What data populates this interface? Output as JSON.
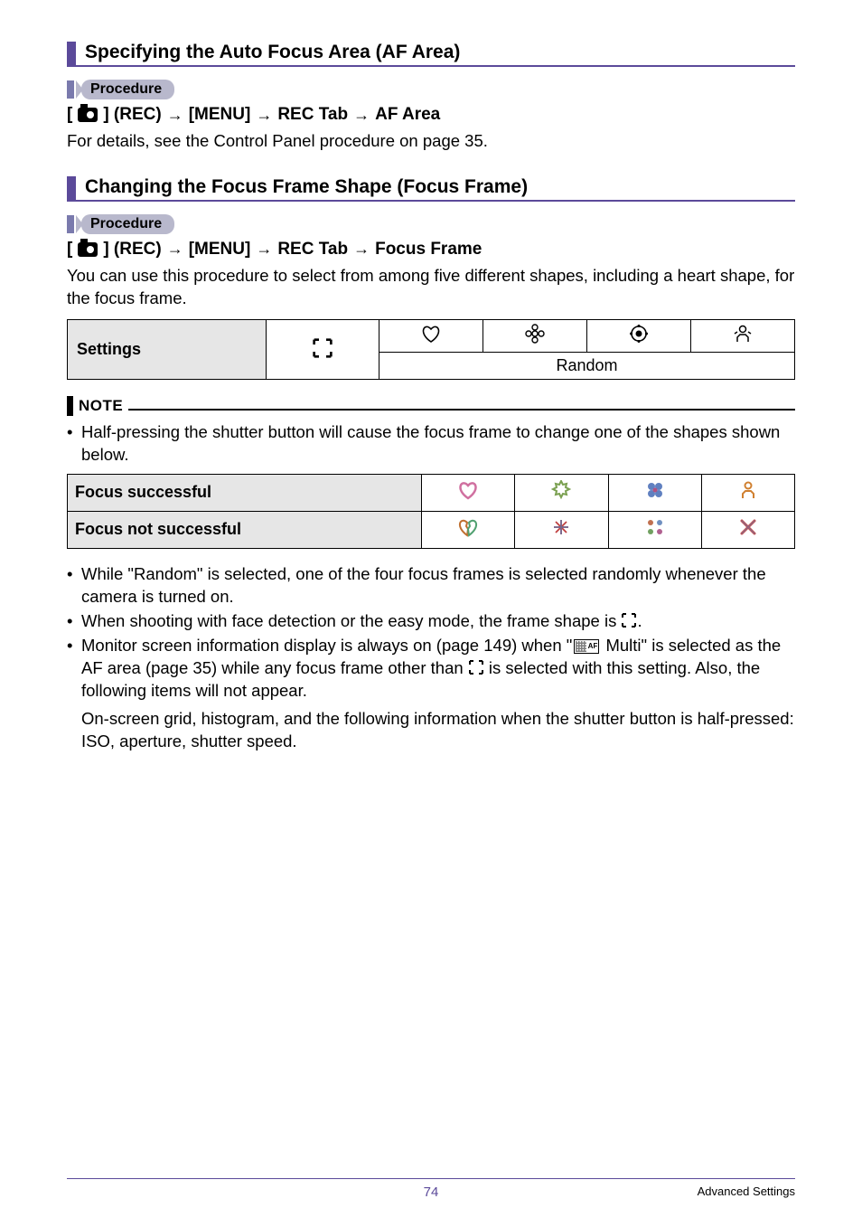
{
  "sections": {
    "af_area": {
      "title": "Specifying the Auto Focus Area (AF Area)",
      "procedure_label": "Procedure",
      "path": [
        "[",
        "] (REC)",
        "[MENU]",
        "REC Tab",
        "AF Area"
      ],
      "body": "For details, see the Control Panel procedure on page 35."
    },
    "focus_frame": {
      "title": "Changing the Focus Frame Shape (Focus Frame)",
      "procedure_label": "Procedure",
      "path": [
        "[",
        "] (REC)",
        "[MENU]",
        "REC Tab",
        "Focus Frame"
      ],
      "intro": "You can use this procedure to select from among five different shapes, including a heart shape, for the focus frame."
    }
  },
  "settings_table": {
    "label": "Settings",
    "shapes": [
      "heart",
      "flower",
      "clover-ring",
      "person"
    ],
    "random_label": "Random"
  },
  "note": {
    "label": "NOTE",
    "bullet1": "Half-pressing the shutter button will cause the focus frame to change one of the shapes shown below."
  },
  "focus_table": {
    "row1": "Focus successful",
    "row2": "Focus not successful"
  },
  "bullets_after": {
    "b1": "While \"Random\" is selected, one of the four focus frames is selected randomly whenever the camera is turned on.",
    "b2_pre": "When shooting with face detection or the easy mode, the frame shape is ",
    "b2_post": ".",
    "b3_pre": "Monitor screen information display is always on (page 149) when \"",
    "b3_mid": " Multi\" is selected as the AF area (page 35) while any focus frame other than ",
    "b3_post": " is selected with this setting. Also, the following items will not appear.",
    "cont": "On-screen grid, histogram, and the following information when the shutter button is half-pressed: ISO, aperture, shutter speed."
  },
  "footer": {
    "page": "74",
    "right": "Advanced Settings"
  }
}
